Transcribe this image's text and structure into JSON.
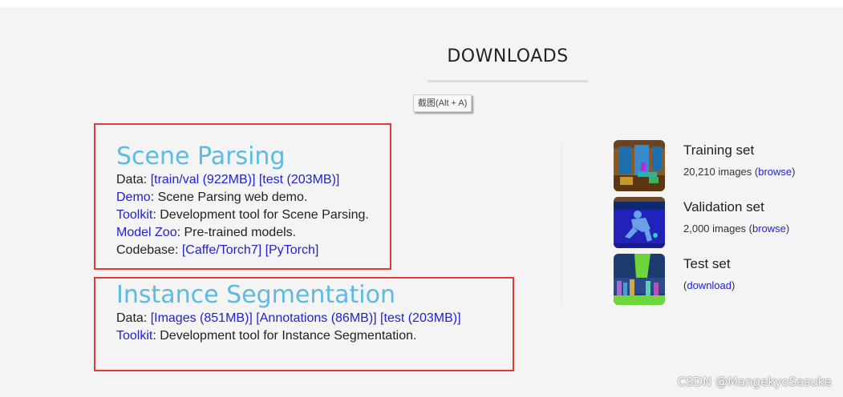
{
  "page": {
    "heading": "DOWNLOADS",
    "tooltip": "截图(Alt + A)",
    "watermark": "CSDN @MangekyoSasuke"
  },
  "scene_parsing": {
    "title": "Scene Parsing",
    "data_label": "Data: ",
    "link_trainval": "[train/val (922MB)]",
    "link_test": "[test (203MB)]",
    "demo_link": "Demo",
    "demo_text": ": Scene Parsing web demo.",
    "toolkit_link": "Toolkit",
    "toolkit_text": ": Development tool for Scene Parsing.",
    "modelzoo_link": "Model Zoo",
    "modelzoo_text": ": Pre-trained models.",
    "codebase_label": "Codebase: ",
    "link_caffe": "[Caffe/Torch7]",
    "link_pytorch": "[PyTorch]"
  },
  "instance_segmentation": {
    "title": "Instance Segmentation",
    "data_label": "Data: ",
    "link_images": "[Images (851MB)]",
    "link_annotations": "[Annotations (86MB)]",
    "link_test": "[test (203MB)]",
    "toolkit_link": "Toolkit",
    "toolkit_text": ": Development tool for Instance Segmentation."
  },
  "datasets": [
    {
      "title": "Training set",
      "count": "20,210 images (",
      "link": "browse",
      "close": ")"
    },
    {
      "title": "Validation set",
      "count": "2,000 images (",
      "link": "browse",
      "close": ")"
    },
    {
      "title": "Test set",
      "count": "(",
      "link": "download",
      "close": ")"
    }
  ],
  "colors": {
    "section_title": "#5bbbe0",
    "link": "#2222cc",
    "annotation_box": "#e53935"
  }
}
